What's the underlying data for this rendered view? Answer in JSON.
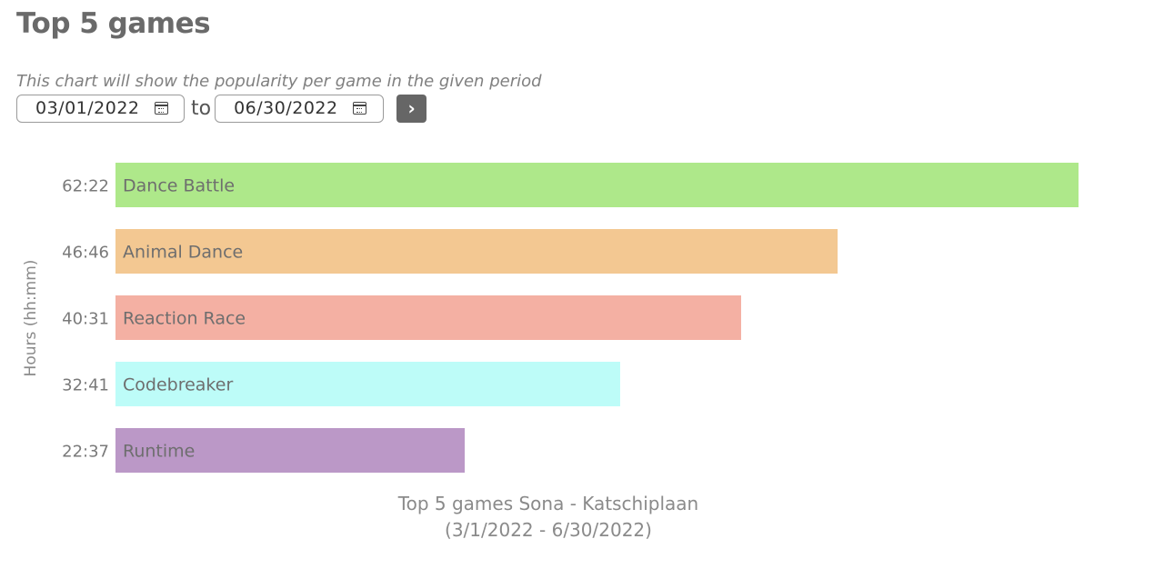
{
  "page": {
    "title": "Top 5 games",
    "description": "This chart will show the popularity per game in the given period"
  },
  "controls": {
    "date_from": "03/01/2022",
    "date_to": "06/30/2022",
    "to_label": "to",
    "calendar_icon": "calendar-icon",
    "submit_icon": "chevron-right-icon",
    "submit_glyph": "›"
  },
  "chart_data": {
    "type": "bar",
    "orientation": "horizontal",
    "title": "Top 5 games Sona - Katschiplaan",
    "subtitle": "(3/1/2022 - 6/30/2022)",
    "ylabel": "Hours (hh:mm)",
    "xlabel": "",
    "categories": [
      "Dance Battle",
      "Animal Dance",
      "Reaction Race",
      "Codebreaker",
      "Runtime"
    ],
    "value_labels": [
      "62:22",
      "46:46",
      "40:31",
      "32:41",
      "22:37"
    ],
    "values_minutes": [
      3742,
      2806,
      2431,
      1961,
      1357
    ],
    "colors": [
      "#aee88a",
      "#f3c892",
      "#f4b0a3",
      "#bdfcf8",
      "#bb98c7"
    ],
    "xlim_minutes": [
      0,
      3742
    ],
    "grid": false,
    "legend": "none"
  }
}
